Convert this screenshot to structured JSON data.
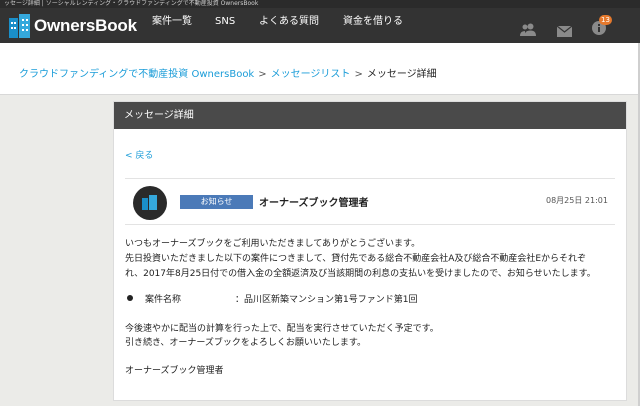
{
  "browser": {
    "tab_title": "ッセージ詳細 | ソーシャルレンディング・クラウドファンディングで不動産投資 OwnersBook"
  },
  "header": {
    "logo_text": "OwnersBook",
    "menu": [
      "案件一覧",
      "SNS",
      "よくある質問",
      "資金を借りる"
    ],
    "icons": [
      "users-icon",
      "mail-icon",
      "info-icon"
    ],
    "notification_count": "13",
    "colors": {
      "nav_bg": "#333333",
      "brand": "#1a8fc9",
      "badge": "#e5792d"
    }
  },
  "breadcrumb": {
    "items": [
      "クラウドファンディングで不動産投資 OwnersBook",
      "メッセージリスト"
    ],
    "separator": ">",
    "current": "メッセージ詳細"
  },
  "panel": {
    "title": "メッセージ詳細",
    "back_label": "< 戻る"
  },
  "message": {
    "tag": "お知らせ",
    "sender": "オーナーズブック管理者",
    "date": "08月25日 21:01",
    "paragraph1": [
      "いつもオーナーズブックをご利用いただきましてありがとうございます。",
      "先日投資いただきました以下の案件につきまして、貸付先である総合不動産会社A及び総合不動産会社Eからそれぞ",
      "れ、2017年8月25日付での借入金の全額返済及び当該期間の利息の支払いを受けましたので、お知らせいたします。"
    ],
    "detail_label": "案件名称",
    "detail_value": "：品川区新築マンション第1号ファンド第1回",
    "paragraph2": [
      "今後速やかに配当の計算を行った上で、配当を実行させていただく予定です。",
      "引き続き、オーナーズブックをよろしくお願いいたします。"
    ],
    "signature": "オーナーズブック管理者"
  }
}
